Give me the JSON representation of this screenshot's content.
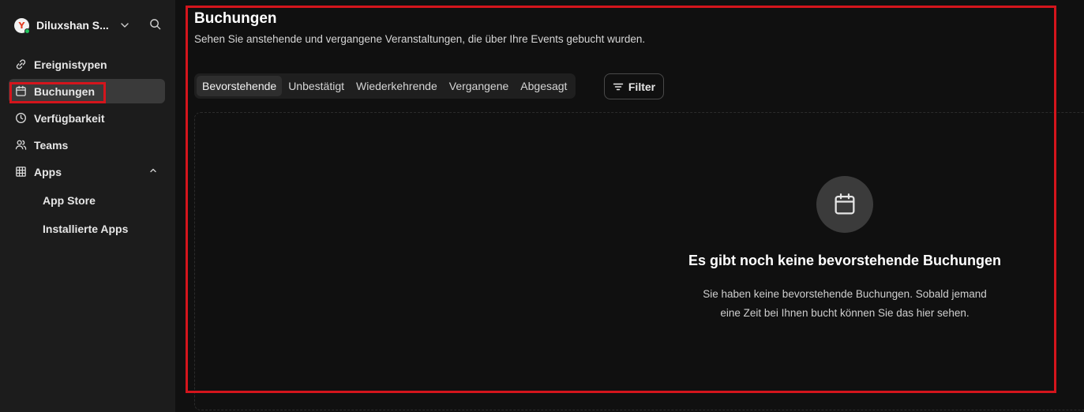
{
  "user": {
    "name": "Diluxshan S...",
    "avatar_letter": "Y"
  },
  "sidebar": {
    "items": [
      {
        "label": "Ereignistypen",
        "icon": "link-icon"
      },
      {
        "label": "Buchungen",
        "icon": "calendar-icon"
      },
      {
        "label": "Verfügbarkeit",
        "icon": "clock-icon"
      },
      {
        "label": "Teams",
        "icon": "users-icon"
      },
      {
        "label": "Apps",
        "icon": "grid-icon"
      }
    ],
    "apps_sub": [
      {
        "label": "App Store"
      },
      {
        "label": "Installierte Apps"
      }
    ]
  },
  "page": {
    "title": "Buchungen",
    "subtitle": "Sehen Sie anstehende und vergangene Veranstaltungen, die über Ihre Events gebucht wurden."
  },
  "tabs": [
    {
      "label": "Bevorstehende"
    },
    {
      "label": "Unbestätigt"
    },
    {
      "label": "Wiederkehrende"
    },
    {
      "label": "Vergangene"
    },
    {
      "label": "Abgesagt"
    }
  ],
  "filter": {
    "label": "Filter"
  },
  "empty": {
    "title": "Es gibt noch keine bevorstehende Buchungen",
    "line1": "Sie haben keine bevorstehende Buchungen. Sobald jemand",
    "line2": "eine Zeit bei Ihnen bucht können Sie das hier sehen."
  },
  "colors": {
    "highlight": "#d4151c",
    "sidebar_bg": "#1c1c1c",
    "main_bg": "#101010",
    "status_online": "#22c55e"
  }
}
